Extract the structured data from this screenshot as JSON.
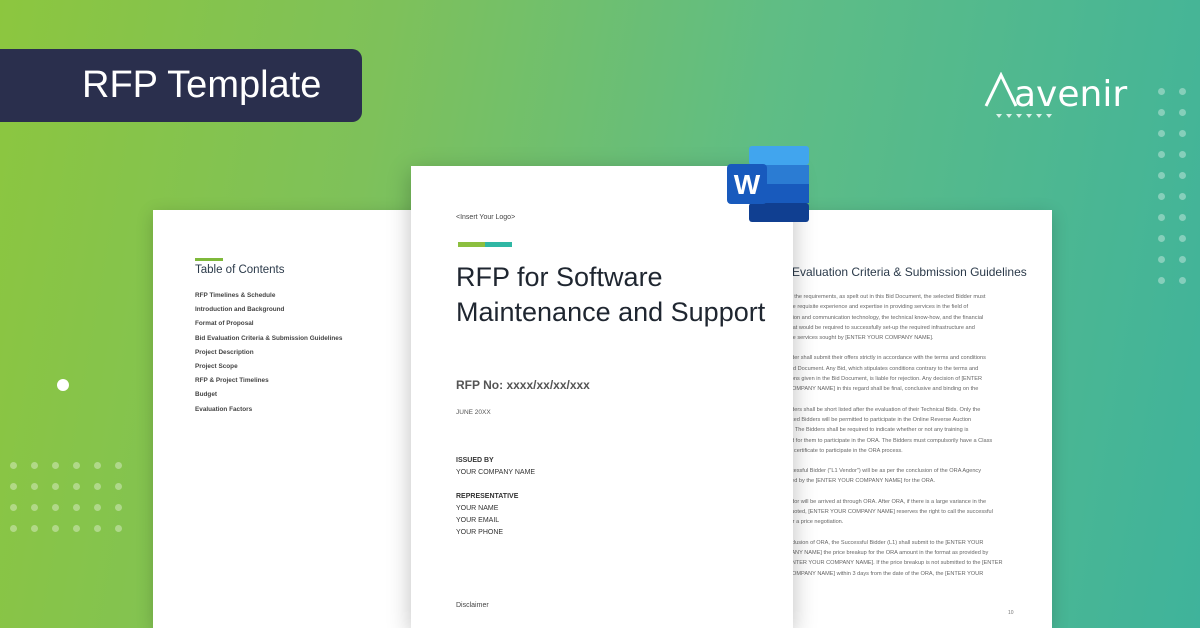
{
  "banner": {
    "title": "RFP Template"
  },
  "brand": {
    "logo_text": "avenir"
  },
  "toc": {
    "title": "Table of Contents",
    "items": [
      "RFP Timelines & Schedule",
      "Introduction and Background",
      "Format of Proposal",
      "Bid Evaluation Criteria & Submission Guidelines",
      "Project Description",
      "Project Scope",
      "RFP & Project Timelines",
      "Budget",
      "Evaluation Factors"
    ]
  },
  "cover": {
    "logo_placeholder": "<Insert Your Logo>",
    "title": "RFP for Software Maintenance and Support",
    "rfp_no": "RFP No: xxxx/xx/xx/xxx",
    "date": "JUNE 20XX",
    "issued_by_label": "ISSUED BY",
    "issued_by_value": "YOUR COMPANY NAME",
    "representative_label": "REPRESENTATIVE",
    "rep_name": "YOUR NAME",
    "rep_email": "YOUR EMAIL",
    "rep_phone": "YOUR PHONE",
    "disclaimer": "Disclaimer"
  },
  "app_icon": {
    "letter": "W",
    "name": "word-icon"
  },
  "evaluation": {
    "title": "Evaluation Criteria & Submission Guidelines",
    "paragraphs": [
      [
        "et the requirements, as spelt out in this Bid Document, the selected Bidder must",
        "the requisite experience and expertise in providing services in the field of",
        "ation and communication technology, the technical know-how, and the financial",
        "that would be required to successfully set-up the required infrastructure and",
        "the services sought by [ENTER YOUR COMPANY NAME]."
      ],
      [
        "dder shall submit their offers strictly in accordance with the terms and conditions",
        "Bid Document. Any Bid, which stipulates conditions contrary to the terms and",
        "tions given in the Bid Document, is liable for rejection. Any decision of [ENTER",
        "COMPANY NAME] in this regard shall be final, conclusive and binding on the"
      ],
      [
        "dders shall be short listed after the evaluation of their Technical Bids. Only the",
        "isted Bidders will be permitted to participate in the Online Reverse Auction",
        "\"). The Bidders shall be required to indicate whether or not any training is",
        "ed for them to participate in the ORA. The Bidders must compulsorily have a Class",
        "al certificate to participate in the ORA process."
      ],
      [
        "ccessful Bidder (\"L1 Vendor\") will be as per the conclusion of the ORA Agency",
        "ned by the [ENTER YOUR COMPANY NAME] for the ORA."
      ],
      [
        "ndor will be arrived at through ORA. After ORA, if there is a large variance in the",
        "quoted, [ENTER YOUR COMPANY NAME] reserves the right to call the successful",
        "for a price negotiation."
      ],
      [
        "nclusion of ORA, the Successful Bidder (L1) shall submit to the [ENTER YOUR",
        "PANY NAME] the price breakup for the ORA amount in the format as provided by",
        "ENTER YOUR COMPANY NAME]. If the price breakup is not submitted to the [ENTER",
        "COMPANY NAME] within 3 days from the date of the ORA, the [ENTER YOUR"
      ]
    ],
    "page_number": "10"
  },
  "colors": {
    "banner_bg": "#2a2f4d",
    "accent_green": "#8cbf3f",
    "accent_teal": "#2fb7a4",
    "word_blue": "#185abd"
  }
}
